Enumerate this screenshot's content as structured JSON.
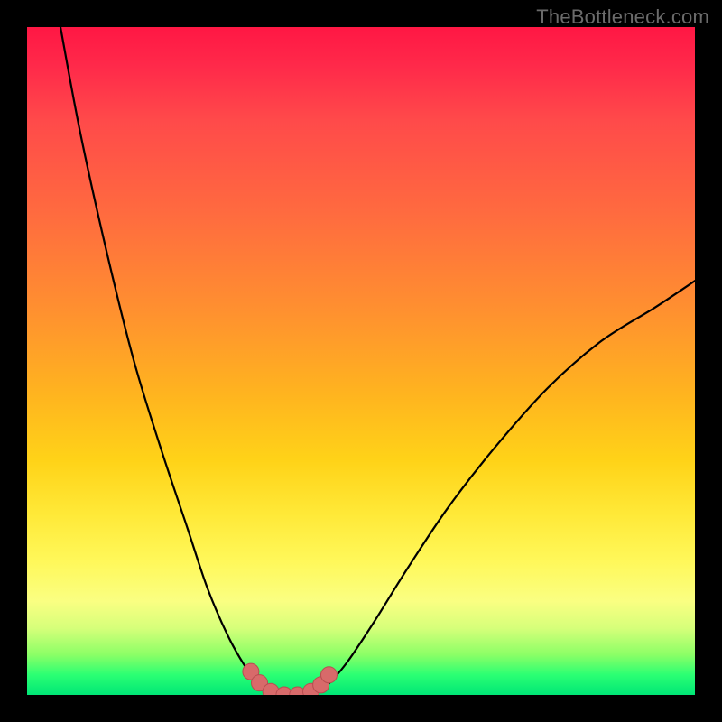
{
  "watermark": "TheBottleneck.com",
  "colors": {
    "frame_bg": "#000000",
    "curve": "#000000",
    "marker_fill": "#d86a6a",
    "marker_stroke": "#b84d50",
    "gradient_top": "#ff1744",
    "gradient_bottom": "#00e676"
  },
  "chart_data": {
    "type": "line",
    "title": "",
    "xlabel": "",
    "ylabel": "",
    "xlim": [
      0,
      100
    ],
    "ylim": [
      0,
      100
    ],
    "curves": [
      {
        "name": "left-branch",
        "x": [
          5,
          8,
          12,
          16,
          20,
          24,
          27,
          30,
          32.5,
          34.5,
          36,
          37
        ],
        "y": [
          100,
          84,
          66,
          50,
          37,
          25,
          16,
          9,
          4.5,
          1.8,
          0.5,
          0
        ]
      },
      {
        "name": "valley",
        "x": [
          37,
          38,
          39,
          40,
          41,
          42,
          43
        ],
        "y": [
          0,
          0,
          0,
          0,
          0,
          0,
          0
        ]
      },
      {
        "name": "right-branch",
        "x": [
          43,
          45,
          48,
          52,
          57,
          63,
          70,
          78,
          86,
          94,
          100
        ],
        "y": [
          0,
          1.5,
          5,
          11,
          19,
          28,
          37,
          46,
          53,
          58,
          62
        ]
      }
    ],
    "markers": {
      "name": "valley-markers",
      "points": [
        {
          "x": 33.5,
          "y": 3.5
        },
        {
          "x": 34.8,
          "y": 1.8
        },
        {
          "x": 36.5,
          "y": 0.5
        },
        {
          "x": 38.5,
          "y": 0
        },
        {
          "x": 40.5,
          "y": 0
        },
        {
          "x": 42.5,
          "y": 0.5
        },
        {
          "x": 44.0,
          "y": 1.5
        },
        {
          "x": 45.2,
          "y": 3.0
        }
      ],
      "radius": 9
    }
  }
}
